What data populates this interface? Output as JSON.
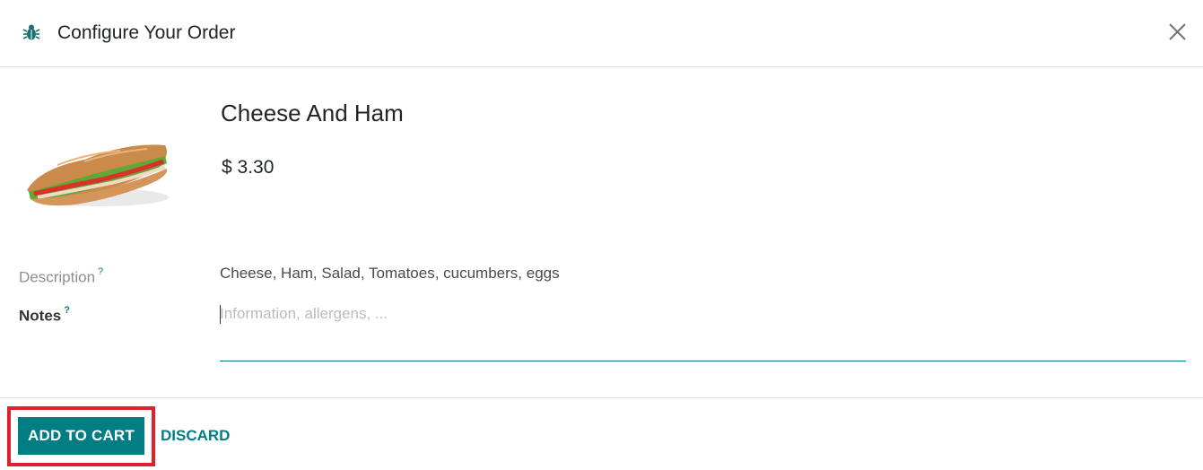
{
  "header": {
    "title": "Configure Your Order",
    "icon": "bug-icon",
    "close_icon": "close-icon"
  },
  "product": {
    "name": "Cheese And Ham",
    "price": "$ 3.30",
    "image": "sandwich-image"
  },
  "fields": {
    "description_label": "Description",
    "description_help": "?",
    "description_value": "Cheese, Ham, Salad, Tomatoes, cucumbers, eggs",
    "notes_label": "Notes",
    "notes_help": "?",
    "notes_placeholder": "Information, allergens, ...",
    "notes_value": ""
  },
  "footer": {
    "add_label": "ADD TO CART",
    "discard_label": "DISCARD"
  },
  "colors": {
    "primary": "#017e84",
    "highlight": "#e0212b"
  }
}
